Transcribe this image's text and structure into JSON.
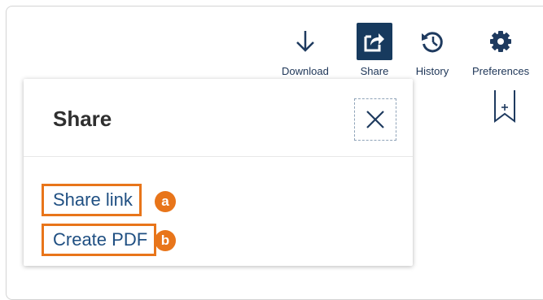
{
  "toolbar": {
    "download_label": "Download",
    "share_label": "Share",
    "history_label": "History",
    "preferences_label": "Preferences"
  },
  "share_panel": {
    "title": "Share",
    "options": [
      {
        "label": "Share link",
        "badge": "a"
      },
      {
        "label": "Create PDF",
        "badge": "b"
      }
    ]
  },
  "colors": {
    "accent_orange": "#e8751a",
    "navy": "#173a5e",
    "link_blue": "#1f4f82"
  },
  "icons": [
    "download-icon",
    "share-icon",
    "history-icon",
    "gear-icon",
    "bookmark-add-icon",
    "close-icon"
  ]
}
